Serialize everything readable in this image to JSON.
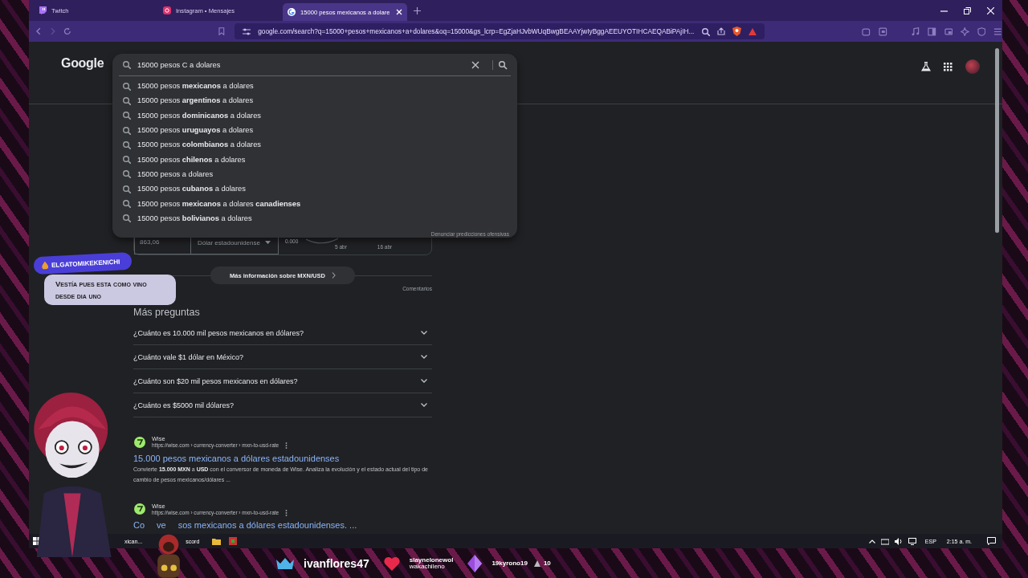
{
  "browser": {
    "tabs": [
      {
        "title": "Twitch",
        "selected": false
      },
      {
        "title": "Instagram • Mensajes",
        "selected": false
      },
      {
        "title": "15000 pesos mexicanos a dolare",
        "selected": true
      }
    ],
    "url": "google.com/search?q=15000+pesos+mexicanos+a+dolares&oq=15000&gs_lcrp=EgZjaHJvbWUqBwgBEAAYjwIyBggAEEUYOTIHCAEQABiPAjIH..."
  },
  "google": {
    "logo": "Google",
    "query": "15000 pesos C a dolares",
    "suggestions": [
      "15000 pesos **mexicanos** a dolares",
      "15000 pesos **argentinos** a dolares",
      "15000 pesos **dominicanos** a dolares",
      "15000 pesos **uruguayos** a dolares",
      "15000 pesos **colombianos** a dolares",
      "15000 pesos **chilenos** a dolares",
      "15000 pesos a dolares",
      "15000 pesos **cubanos** a dolares",
      "15000 pesos **mexicanos** a dolares **canadienses**",
      "15000 pesos **bolivianos** a dolares"
    ],
    "report": "Denunciar predicciones ofensivas",
    "converter": {
      "amount": "863,06",
      "currency": "Dólar estadounidense",
      "y_tick": "0.000",
      "x_labels": [
        "5 abr",
        "16 abr"
      ]
    },
    "more_info": "Más información sobre MXN/USD",
    "feedback": "Comentarios",
    "questions": {
      "title": "Más preguntas",
      "items": [
        {
          "text": "¿Cuánto es 10.000 mil pesos mexicanos en dólares?",
          "expanded": false
        },
        {
          "text": "¿Cuánto vale $1 dólar en México?",
          "expanded": false
        },
        {
          "text": "¿Cuánto son $20 mil pesos mexicanos en dólares?",
          "expanded": false
        },
        {
          "text": "¿Cuánto es $5000 mil dólares?",
          "expanded": false
        }
      ]
    },
    "results": [
      {
        "site": "Wise",
        "url": "https://wise.com › currency-converter › mxn-to-usd-rate",
        "title_parts": [
          "15.000 pesos mexicanos a dólares estadounidenses"
        ],
        "snippet": "Convierte **15.000 MXN** a **USD** con el conversor de moneda de Wise. Analiza la evolución y el estado actual del tipo de cambio de pesos mexicanos/dólares ..."
      },
      {
        "site": "Wise",
        "url": "https://wise.com › currency-converter › mxn-to-usd-rate",
        "title_parts": [
          "Co",
          "ve",
          "sos mexicanos a dólares estadounidenses. ..."
        ]
      }
    ]
  },
  "taskbar": {
    "items": [
      "xican...",
      "scord"
    ],
    "language": "ESP",
    "time": "2:15 a. m."
  },
  "stream": {
    "chat": {
      "user": "ELGATOMIKEKENICHI",
      "message": "Vestía pues esta como vino desde dia uno"
    },
    "alerts": [
      {
        "kind": "crown",
        "lines": [
          "ivanflores47"
        ]
      },
      {
        "kind": "heart",
        "lines": [
          "slaynelonewol",
          "wakachileno"
        ]
      },
      {
        "kind": "diamond",
        "lines": [
          "19kyrono19"
        ]
      },
      {
        "kind": "triangle",
        "lines": [
          "10"
        ]
      }
    ]
  }
}
